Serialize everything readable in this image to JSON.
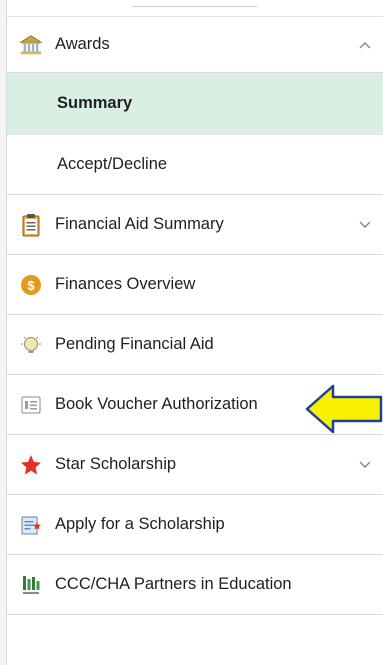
{
  "menu": {
    "awards": {
      "label": "Awards",
      "icon": "bank-icon",
      "expanded": true
    },
    "awards_children": [
      {
        "label": "Summary",
        "selected": true
      },
      {
        "label": "Accept/Decline",
        "selected": false
      }
    ],
    "items": [
      {
        "label": "Financial Aid Summary",
        "icon": "clipboard-icon",
        "has_chevron": true
      },
      {
        "label": "Finances Overview",
        "icon": "dollar-coin-icon",
        "has_chevron": false
      },
      {
        "label": "Pending Financial Aid",
        "icon": "lightbulb-icon",
        "has_chevron": false
      },
      {
        "label": "Book Voucher Authorization",
        "icon": "voucher-icon",
        "has_chevron": false
      },
      {
        "label": "Star Scholarship",
        "icon": "star-icon",
        "has_chevron": true
      },
      {
        "label": "Apply for a Scholarship",
        "icon": "scholarship-form-icon",
        "has_chevron": false
      },
      {
        "label": "CCC/CHA Partners in Education",
        "icon": "cha-logo-icon",
        "has_chevron": false
      }
    ]
  },
  "colors": {
    "selected_bg": "#d9efe3",
    "arrow_fill": "#f7f200",
    "arrow_stroke": "#1f3f9a",
    "star": "#e0312a",
    "coin": "#e39a1b"
  }
}
